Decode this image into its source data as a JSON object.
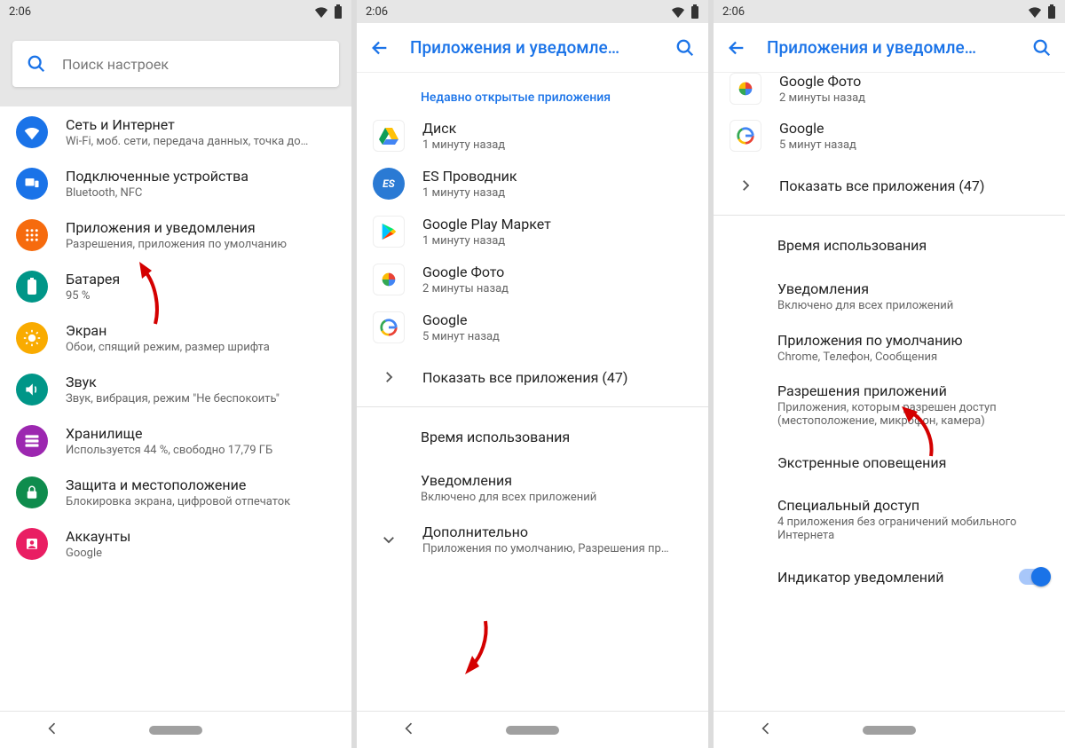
{
  "statusbar": {
    "time": "2:06"
  },
  "screen1": {
    "search_placeholder": "Поиск настроек",
    "items": [
      {
        "title": "Сеть и Интернет",
        "sub": "Wi-Fi, моб. сети, передача данных, точка до…"
      },
      {
        "title": "Подключенные устройства",
        "sub": "Bluetooth, NFC"
      },
      {
        "title": "Приложения и уведомления",
        "sub": "Разрешения, приложения по умолчанию"
      },
      {
        "title": "Батарея",
        "sub": "95 %"
      },
      {
        "title": "Экран",
        "sub": "Обои, спящий режим, размер шрифта"
      },
      {
        "title": "Звук",
        "sub": "Звук, вибрация, режим \"Не беспокоить\""
      },
      {
        "title": "Хранилище",
        "sub": "Используется 44 %, свободно 17,79 ГБ"
      },
      {
        "title": "Защита и местоположение",
        "sub": "Блокировка экрана, цифровой отпечаток"
      },
      {
        "title": "Аккаунты",
        "sub": "Google"
      }
    ]
  },
  "screen2": {
    "appbar_title": "Приложения и уведомле…",
    "recent_header": "Недавно открытые приложения",
    "apps": [
      {
        "title": "Диск",
        "sub": "1 минуту назад"
      },
      {
        "title": "ES Проводник",
        "sub": "1 минуту назад"
      },
      {
        "title": "Google Play Маркет",
        "sub": "1 минуту назад"
      },
      {
        "title": "Google Фото",
        "sub": "2 минуты назад"
      },
      {
        "title": "Google",
        "sub": "5 минут назад"
      }
    ],
    "show_all": "Показать все приложения (47)",
    "usage": "Время использования",
    "notif_title": "Уведомления",
    "notif_sub": "Включено для всех приложений",
    "more_title": "Дополнительно",
    "more_sub": "Приложения по умолчанию, Разрешения пр…"
  },
  "screen3": {
    "appbar_title": "Приложения и уведомле…",
    "apps": [
      {
        "title": "Google Фото",
        "sub": "2 минуты назад"
      },
      {
        "title": "Google",
        "sub": "5 минут назад"
      }
    ],
    "show_all": "Показать все приложения (47)",
    "usage": "Время использования",
    "notif_title": "Уведомления",
    "notif_sub": "Включено для всех приложений",
    "default_title": "Приложения по умолчанию",
    "default_sub": "Chrome, Телефон, Сообщения",
    "perm_title": "Разрешения приложений",
    "perm_sub": "Приложения, которым разрешен доступ (местоположение, микрофон, камера)",
    "emergency": "Экстренные оповещения",
    "special_title": "Специальный доступ",
    "special_sub": "4 приложения без ограничений мобильного Интернета",
    "indicator": "Индикатор уведомлений"
  }
}
